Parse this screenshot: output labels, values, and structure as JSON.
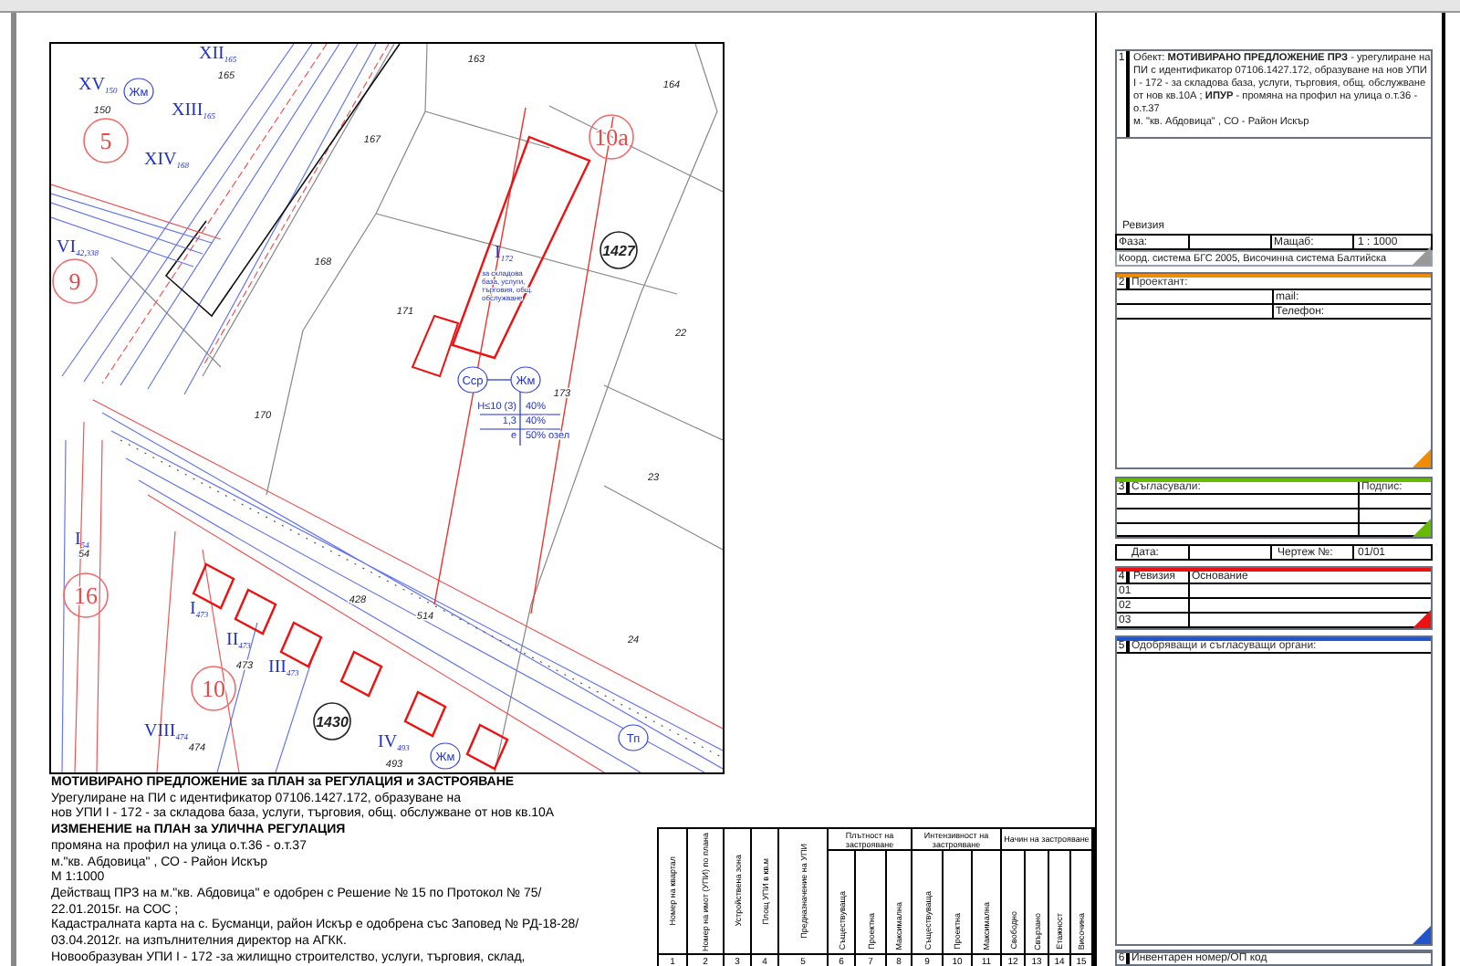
{
  "map": {
    "labels": [
      {
        "kind": "number",
        "text": "163"
      },
      {
        "kind": "number",
        "text": "164"
      },
      {
        "kind": "number",
        "text": "167"
      },
      {
        "kind": "number",
        "text": "168"
      },
      {
        "kind": "number",
        "text": "171"
      },
      {
        "kind": "number",
        "text": "22"
      },
      {
        "kind": "number",
        "text": "173"
      },
      {
        "kind": "number",
        "text": "23"
      },
      {
        "kind": "number",
        "text": "170"
      },
      {
        "kind": "number",
        "text": "24"
      },
      {
        "kind": "number",
        "text": "150"
      },
      {
        "kind": "number",
        "text": "54"
      },
      {
        "kind": "number",
        "text": "473"
      },
      {
        "kind": "number",
        "text": "474"
      },
      {
        "kind": "number",
        "text": "493"
      },
      {
        "kind": "number",
        "text": "428"
      },
      {
        "kind": "number",
        "text": "514"
      },
      {
        "kind": "zone",
        "text": "5"
      },
      {
        "kind": "zone",
        "text": "9"
      },
      {
        "kind": "zone",
        "text": "10а"
      },
      {
        "kind": "zone",
        "text": "16"
      },
      {
        "kind": "zone",
        "text": "10"
      },
      {
        "kind": "cadastre",
        "text": "1427"
      },
      {
        "kind": "cadastre",
        "text": "1430"
      },
      {
        "kind": "use",
        "text": "Жм"
      },
      {
        "kind": "use",
        "text": "Сср"
      },
      {
        "kind": "use",
        "text": "Жм"
      },
      {
        "kind": "use",
        "text": "Жм"
      },
      {
        "kind": "use",
        "text": "Тп"
      },
      {
        "kind": "upi",
        "text": "XV",
        "sub": "150"
      },
      {
        "kind": "upi",
        "text": "XII",
        "sub": "165"
      },
      {
        "kind": "upi",
        "text": "XIII",
        "sub": "165"
      },
      {
        "kind": "upi",
        "text": "XIV",
        "sub": "168"
      },
      {
        "kind": "upi",
        "text": "VI",
        "sub": "42,338"
      },
      {
        "kind": "upi",
        "text": "I",
        "sub": "172"
      },
      {
        "kind": "upi",
        "text": "I",
        "sub": "54"
      },
      {
        "kind": "upi",
        "text": "I",
        "sub": "473"
      },
      {
        "kind": "upi",
        "text": "II",
        "sub": "473"
      },
      {
        "kind": "upi",
        "text": "III",
        "sub": "473"
      },
      {
        "kind": "upi",
        "text": "VIII",
        "sub": "474"
      },
      {
        "kind": "upi",
        "text": "IV",
        "sub": "493"
      },
      {
        "kind": "number",
        "text": "165"
      }
    ],
    "purpose_note": [
      "за складова",
      "база, услуги,",
      "търговия, общ.",
      "обслужване"
    ],
    "indicators": [
      [
        "Н≤10 (3)",
        "40%"
      ],
      [
        "1,3",
        "40%"
      ],
      [
        "е",
        "50% озел"
      ]
    ]
  },
  "legend_text": [
    {
      "text": "МОТИВИРАНО ПРЕДЛОЖЕНИЕ за ПЛАН за РЕГУЛАЦИЯ и ЗАСТРОЯВАНЕ",
      "bold": true
    },
    {
      "text": "Урегулиране на ПИ с идентификатор 07106.1427.172, образуване на",
      "bold": false
    },
    {
      "text": "нов УПИ I - 172 - за складова база, услуги, търговия, общ. обслужване от нов кв.10А",
      "bold": false
    },
    {
      "text": "ИЗМЕНЕНИЕ на ПЛАН за УЛИЧНА РЕГУЛАЦИЯ",
      "bold": true
    },
    {
      "text": "промяна на профил  на улица о.т.36 - о.т.37",
      "bold": false
    },
    {
      "text": "м.\"кв. Абдовица\" , СО - Район Искър",
      "bold": false
    },
    {
      "text": "М 1:1000",
      "bold": false
    },
    {
      "text": "Действащ ПРЗ на м.\"кв. Абдовица\" е одобрен с Решение № 15 по Протокол № 75/",
      "bold": false
    },
    {
      "text": "22.01.2015г. на СОС ;",
      "bold": false
    },
    {
      "text": "Кадастралната карта  на с. Бусманци, район Искър е одобрена със Заповед № РД-18-28/",
      "bold": false
    },
    {
      "text": "03.04.2012г. на изпълнителния директор на АГКК.",
      "bold": false
    },
    {
      "text": "Новообразуван УПИ I - 172 -за жилищно строителство, услуги, търговия, склад,",
      "bold": false
    }
  ],
  "table": {
    "groups": [
      {
        "label": "Плътност на застрояване"
      },
      {
        "label": "Интензивност на застрояване"
      },
      {
        "label": "Начин на застрояване"
      }
    ],
    "columns": [
      {
        "header": "Номер на квартал",
        "number": "1"
      },
      {
        "header": "Номер на имот (УПИ) по плана",
        "number": "2"
      },
      {
        "header": "Устройствена зона",
        "number": "3"
      },
      {
        "header": "Площ УПИ в кв.м",
        "number": "4"
      },
      {
        "header": "Предназначение на УПИ",
        "number": "5"
      },
      {
        "header": "Съществуваща",
        "number": "6"
      },
      {
        "header": "Проектна",
        "number": "7"
      },
      {
        "header": "Максимална",
        "number": "8"
      },
      {
        "header": "Съществуваща",
        "number": "9"
      },
      {
        "header": "Проектна",
        "number": "10"
      },
      {
        "header": "Максимална",
        "number": "11"
      },
      {
        "header": "Свободно",
        "number": "12"
      },
      {
        "header": "Свързано",
        "number": "13"
      },
      {
        "header": "Етажност",
        "number": "14"
      },
      {
        "header": "Височина",
        "number": "15"
      }
    ]
  },
  "title_block": {
    "object": {
      "number": "1",
      "text": "Обект: **МОТИВИРАНО ПРЕДЛОЖЕНИЕ ПРЗ** - урегулиране на ПИ с идентификатор 07106.1427.172, образуване на нов УПИ I - 172 - за складова база, услуги, търговия, общ. обслужване от нов кв.10А ; **ИПУР** - промяна на профил  на улица о.т.36 - о.т.37",
      "location": "м. \"кв. Абдовица\" , СО - Район Искър"
    },
    "revision_label": "Ревизия",
    "phase_label": "Фаза:",
    "scale_label": "Мащаб:",
    "scale": "1 : 1000",
    "coords": "Коорд. система БГС 2005, Височинна система Балтийска",
    "designer": {
      "number": "2",
      "label": "Проектант:",
      "mail": "mail:",
      "phone": "Телефон:",
      "color": "#f08c00"
    },
    "approvers": {
      "number": "3",
      "label": "Съгласували:",
      "signature": "Подпис:",
      "color": "#66bb00"
    },
    "date_label": "Дата:",
    "drawing_label": "Чертеж №:",
    "drawing_no": "01/01",
    "revisions": {
      "number": "4",
      "col_revision": "Ревизия",
      "col_basis": "Основание",
      "rows": [
        "01",
        "02",
        "03"
      ],
      "color": "#ee1111"
    },
    "authorities": {
      "number": "5",
      "label": "Одобряващи и съгласуващи органи:",
      "color": "#2255cc"
    },
    "inventory": {
      "number": "6",
      "label": "Инвентарен номер/ОП код"
    }
  }
}
